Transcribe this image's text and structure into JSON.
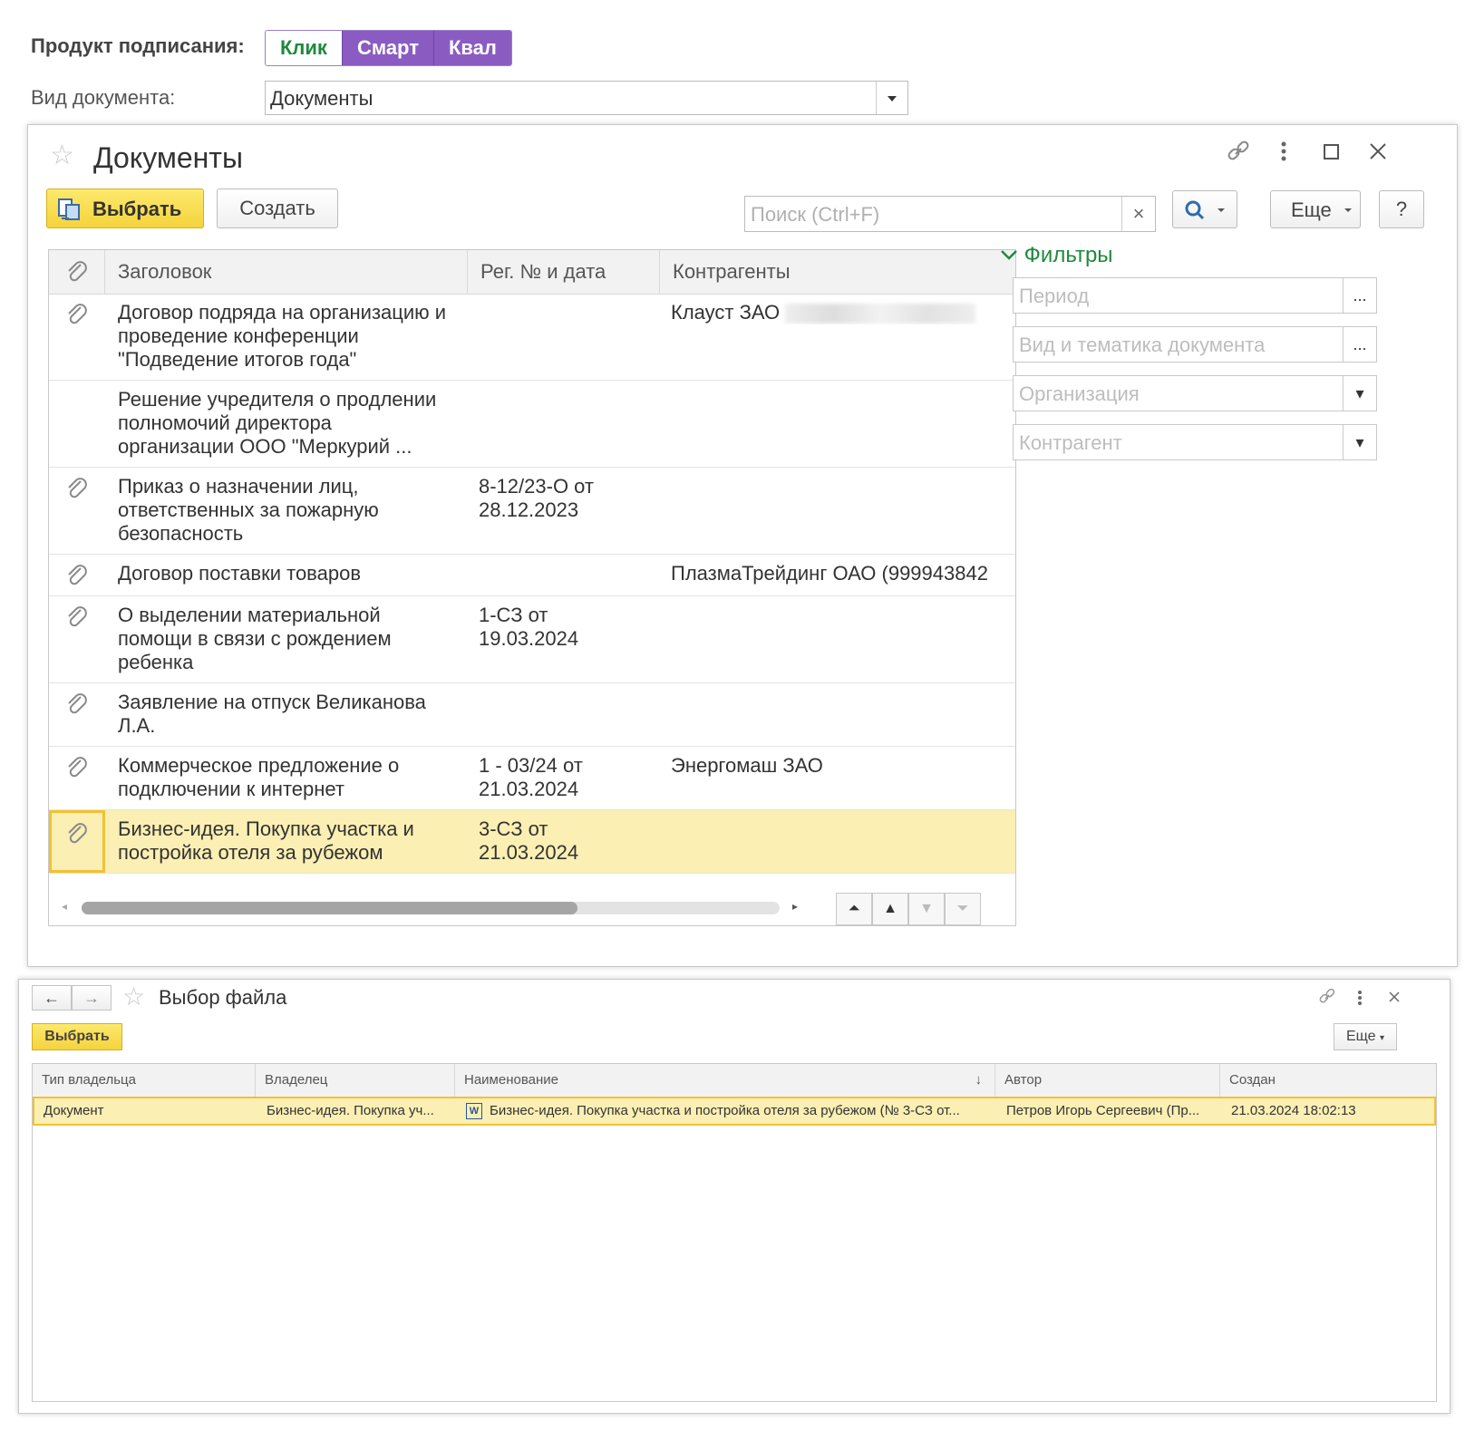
{
  "form": {
    "product_label": "Продукт подписания:",
    "product_options": [
      "Клик",
      "Смарт",
      "Квал"
    ],
    "doctype_label": "Вид документа:",
    "doctype_value": "Документы"
  },
  "docs_window": {
    "title": "Документы",
    "select_button": "Выбрать",
    "create_button": "Создать",
    "search_placeholder": "Поиск (Ctrl+F)",
    "more_button": "Еще",
    "help_button": "?",
    "columns": [
      "Заголовок",
      "Рег. № и дата",
      "Контрагенты"
    ],
    "rows": [
      {
        "attachment": true,
        "title": "Договор подряда на организацию и\nпроведение конференции\n\"Подведение итогов года\"",
        "reg": "",
        "contractor": "Клауст ЗАО"
      },
      {
        "attachment": false,
        "title": "Решение учредителя о продлении\nполномочий директора\nорганизации ООО \"Меркурий ...",
        "reg": "",
        "contractor": ""
      },
      {
        "attachment": true,
        "title": "Приказ о назначении лиц,\nответственных за пожарную\nбезопасность",
        "reg": "8-12/23-О от\n28.12.2023",
        "contractor": ""
      },
      {
        "attachment": true,
        "title": "Договор поставки товаров",
        "reg": "",
        "contractor": "ПлазмаТрейдинг ОАО (999943842"
      },
      {
        "attachment": true,
        "title": "О выделении материальной\nпомощи в связи с рождением\nребенка",
        "reg": "1-СЗ от\n19.03.2024",
        "contractor": ""
      },
      {
        "attachment": true,
        "title": "Заявление на отпуск Великанова\nЛ.А.",
        "reg": "",
        "contractor": ""
      },
      {
        "attachment": true,
        "title": "Коммерческое предложение о\nподключении к интернет",
        "reg": "1 - 03/24 от\n21.03.2024",
        "contractor": "Энергомаш ЗАО"
      },
      {
        "attachment": true,
        "title": "Бизнес-идея. Покупка участка и\nпостройка отеля за рубежом",
        "reg": "3-СЗ от\n21.03.2024",
        "contractor": "",
        "selected": true
      }
    ],
    "scroll_position": 0.71,
    "filters": {
      "label": "Фильтры",
      "fields": [
        {
          "placeholder": "Период",
          "side": "..."
        },
        {
          "placeholder": "Вид и тематика документа",
          "side": "..."
        },
        {
          "placeholder": "Организация",
          "side": "▾"
        },
        {
          "placeholder": "Контрагент",
          "side": "▾"
        }
      ]
    }
  },
  "file_window": {
    "title": "Выбор файла",
    "select_button": "Выбрать",
    "more_button": "Еще",
    "columns": [
      "Тип владельца",
      "Владелец",
      "Наименование",
      "Автор",
      "Создан"
    ],
    "sort_indicator": "↓",
    "row": {
      "owner_type": "Документ",
      "owner": "Бизнес-идея. Покупка уч...",
      "name": "Бизнес-идея. Покупка участка и постройка отеля за рубежом (№ 3-СЗ от...",
      "author": "Петров Игорь Сергеевич (Пр...",
      "created": "21.03.2024 18:02:13"
    }
  },
  "colors": {
    "accent_green": "#1f8a3d",
    "accent_purple": "#8a5cc2",
    "select_yellow": "#f5d33c",
    "row_highlight": "#fbefb3"
  }
}
